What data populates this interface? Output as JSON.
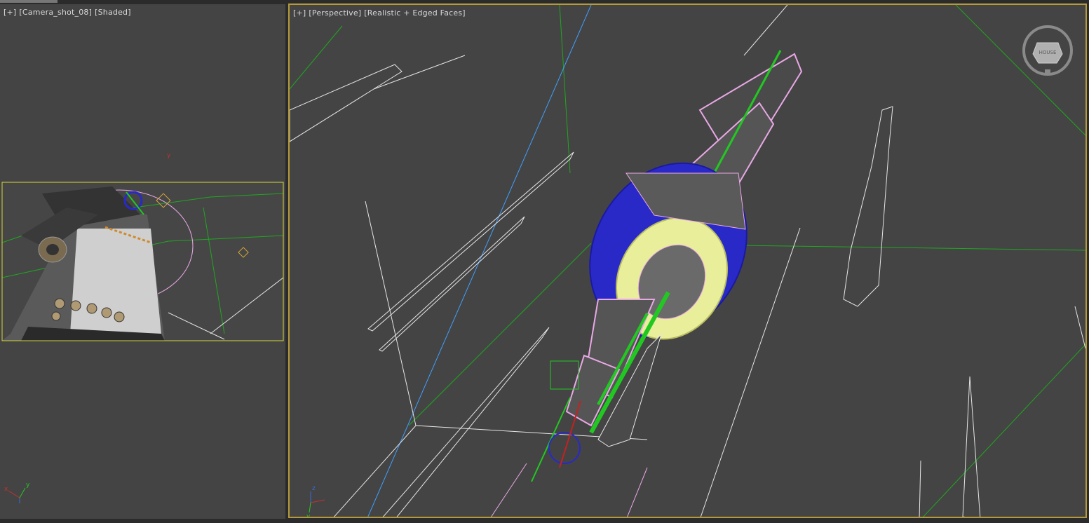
{
  "viewports": {
    "left": {
      "label_plus": "[+]",
      "label_camera": "[Camera_shot_08]",
      "label_mode": "[Shaded]",
      "axis_y_marker": "y"
    },
    "right": {
      "label_plus": "[+]",
      "label_view": "[Perspective]",
      "label_mode": "[Realistic + Edged Faces]",
      "viewcube_face": "HOUSE"
    }
  },
  "axis_gizmo": {
    "x": "x",
    "y": "y",
    "z": "z"
  },
  "colors": {
    "viewport_bg": "#444444",
    "active_border": "#b59a3c",
    "safe_frame": "#d6d63a",
    "wire_white": "#e6e6e6",
    "wire_pink": "#e9a8e6",
    "wire_blue": "#2929c8",
    "wire_yellow": "#e9ee9a",
    "wire_green": "#22c822",
    "grid_green": "#1fa81f",
    "grid_blue": "#3fa0ff"
  }
}
